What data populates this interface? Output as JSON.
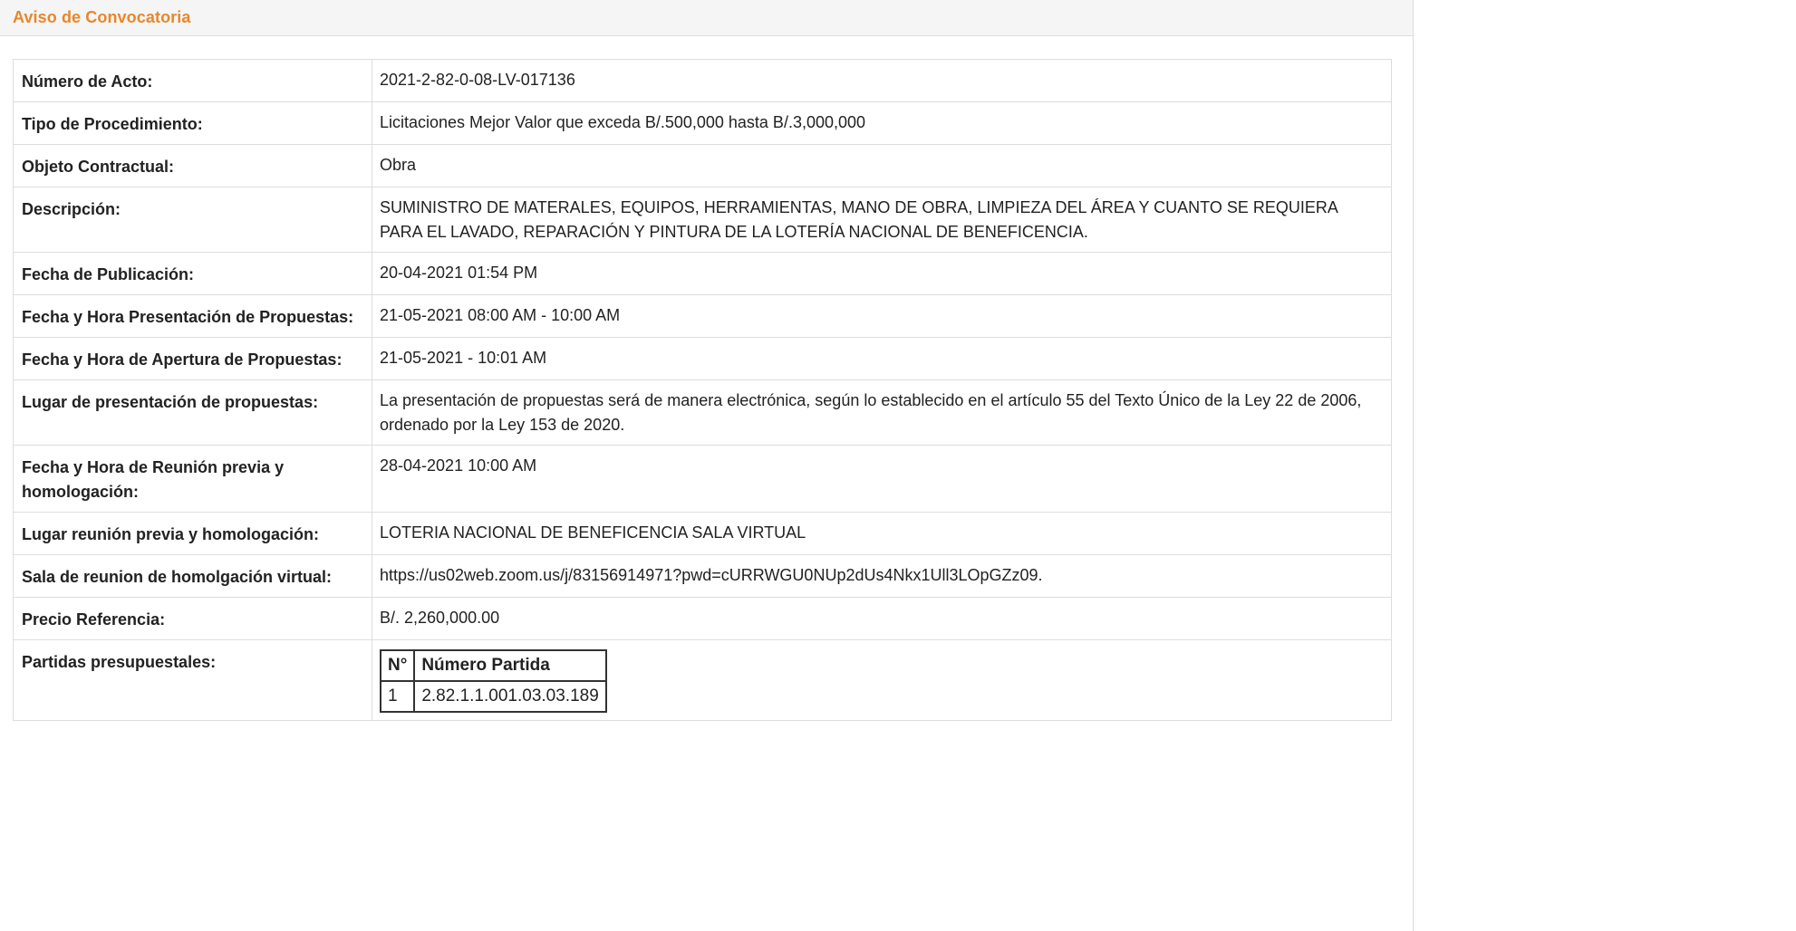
{
  "panel": {
    "title": "Aviso de Convocatoria"
  },
  "rows": [
    {
      "label": "Número de Acto:",
      "value": "2021-2-82-0-08-LV-017136"
    },
    {
      "label": "Tipo de Procedimiento:",
      "value": "Licitaciones Mejor Valor que exceda B/.500,000 hasta B/.3,000,000"
    },
    {
      "label": "Objeto Contractual:",
      "value": "Obra"
    },
    {
      "label": "Descripción:",
      "value": "SUMINISTRO DE MATERALES, EQUIPOS, HERRAMIENTAS, MANO DE OBRA, LIMPIEZA DEL ÁREA Y CUANTO SE REQUIERA PARA EL LAVADO, REPARACIÓN Y PINTURA DE LA LOTERÍA NACIONAL DE BENEFICENCIA."
    },
    {
      "label": "Fecha de Publicación:",
      "value": "20-04-2021 01:54 PM"
    },
    {
      "label": "Fecha y Hora Presentación de Propuestas:",
      "value": "21-05-2021 08:00 AM - 10:00 AM"
    },
    {
      "label": "Fecha y Hora de Apertura de Propuestas:",
      "value": "21-05-2021 - 10:01 AM"
    },
    {
      "label": "Lugar de presentación de propuestas:",
      "value": "La presentación de propuestas será de manera electrónica, según lo establecido en el artículo 55 del Texto Único de la Ley 22 de 2006, ordenado por la Ley 153 de 2020."
    },
    {
      "label": "Fecha y Hora de Reunión previa y homologación:",
      "value": "28-04-2021 10:00 AM"
    },
    {
      "label": "Lugar reunión previa y homologación:",
      "value": "LOTERIA NACIONAL DE BENEFICENCIA SALA VIRTUAL"
    },
    {
      "label": "Sala de reunion de homolgación virtual:",
      "value": "https://us02web.zoom.us/j/83156914971?pwd=cURRWGU0NUp2dUs4Nkx1Ull3LOpGZz09."
    },
    {
      "label": "Precio Referencia:",
      "value": "B/. 2,260,000.00"
    }
  ],
  "partidas": {
    "label": "Partidas presupuestales:",
    "headers": [
      "N°",
      "Número Partida"
    ],
    "rows": [
      [
        "1",
        "2.82.1.1.001.03.03.189"
      ]
    ]
  }
}
